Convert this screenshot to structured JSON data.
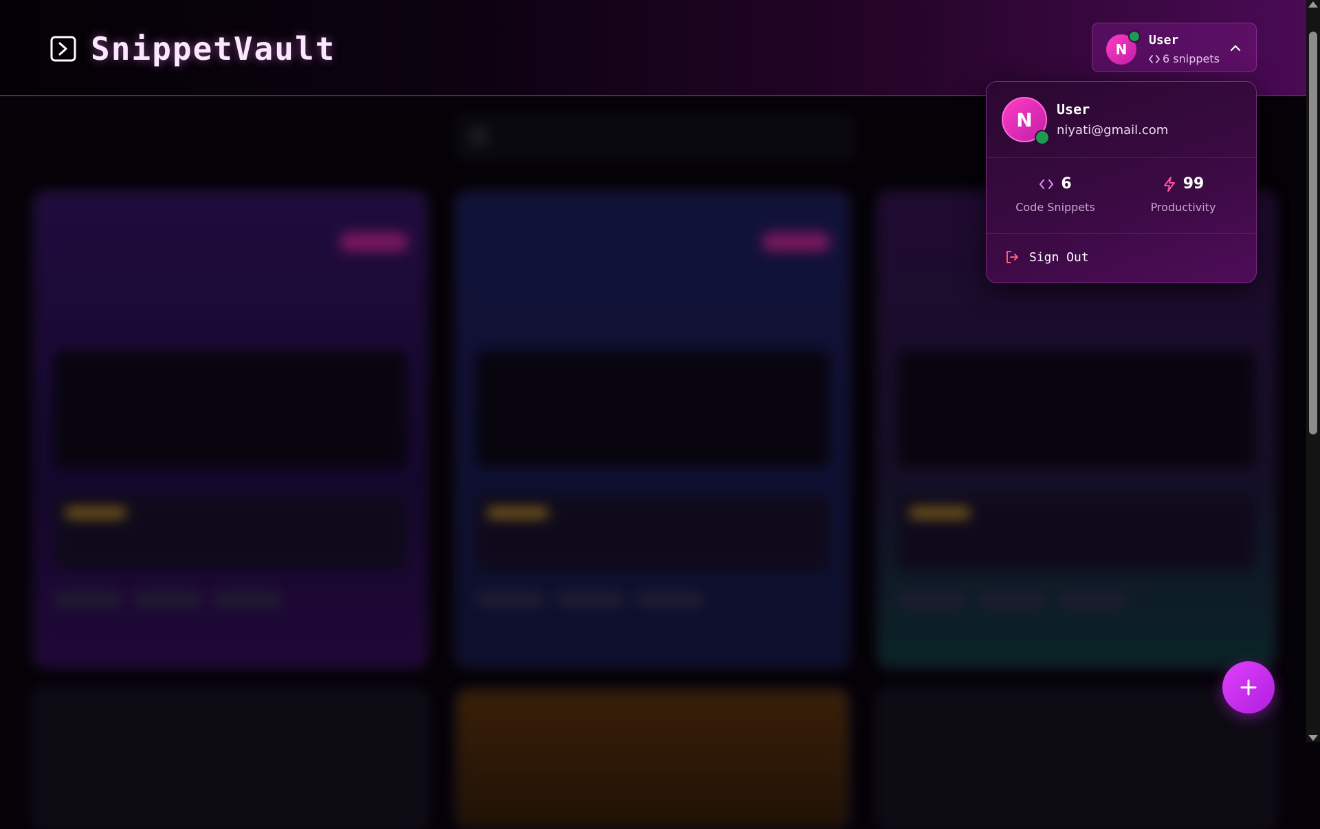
{
  "app": {
    "title": "SnippetVault"
  },
  "header": {
    "user_button": {
      "avatar_initial": "N",
      "name": "User",
      "snippet_count_label": "6 snippets"
    }
  },
  "user_menu": {
    "avatar_initial": "N",
    "name": "User",
    "email": "niyati@gmail.com",
    "stats": [
      {
        "icon": "code-icon",
        "value": "6",
        "label": "Code Snippets"
      },
      {
        "icon": "lightning-icon",
        "value": "99",
        "label": "Productivity"
      }
    ],
    "sign_out_label": "Sign Out"
  },
  "fab": {
    "icon": "plus-icon"
  },
  "colors": {
    "accent": "#e040fb",
    "avatar": "#ff3cc4",
    "online": "#1f9a55",
    "sign_out_icon": "#ff5a7a"
  }
}
